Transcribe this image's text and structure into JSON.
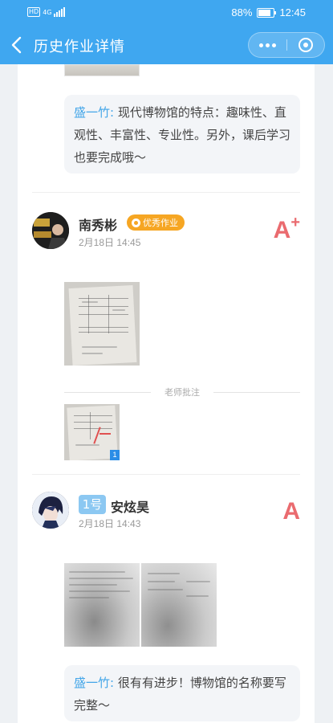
{
  "status_bar": {
    "network": "HD",
    "signal_label": "4G",
    "battery": "88%",
    "time": "12:45"
  },
  "header": {
    "title": "历史作业详情",
    "back_icon": "chevron-left-icon",
    "more_icon": "more-dots-icon",
    "close_icon": "target-close-icon"
  },
  "submissions_top": {
    "teacher_comment": {
      "author": "盛一竹:",
      "text": " 现代博物馆的特点：趣味性、直观性、丰富性、专业性。另外，课后学习也要完成哦～"
    }
  },
  "submissions": [
    {
      "name": "南秀彬",
      "badge": "优秀作业",
      "time": "2月18日 14:45",
      "grade": "A",
      "grade_suffix": "+",
      "annotation_label": "老师批注",
      "annotation_count": "1"
    },
    {
      "number_badge": "1号",
      "name": "安炫昊",
      "time": "2月18日 14:43",
      "grade": "A",
      "teacher_comment": {
        "author": "盛一竹:",
        "text": " 很有有进步！博物馆的名称要写完整～"
      }
    }
  ],
  "colors": {
    "primary": "#3fa7f0",
    "grade": "#ea6b6f",
    "badge": "#f6a623",
    "comment_author": "#42a5e8"
  }
}
